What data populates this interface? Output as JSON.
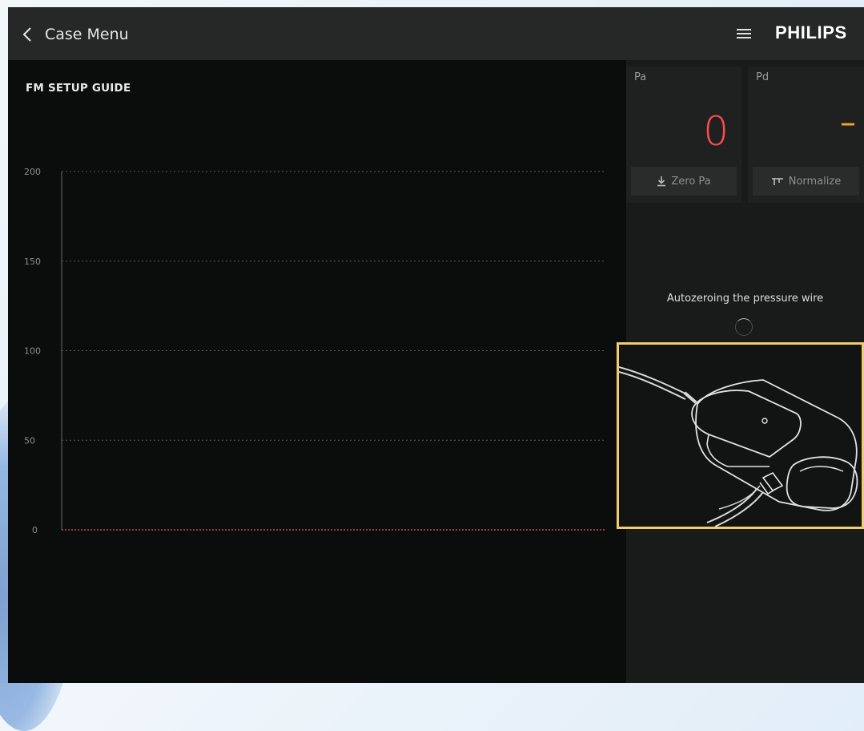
{
  "header": {
    "back_label": "Case Menu",
    "brand": "PHILIPS",
    "icons": {
      "back": "chevron-left-icon",
      "menu": "hamburger-menu-icon"
    }
  },
  "guide": {
    "title": "FM SETUP GUIDE"
  },
  "chart_data": {
    "type": "line",
    "title": "",
    "xlabel": "",
    "ylabel": "",
    "ylim": [
      0,
      200
    ],
    "yticks": [
      "200",
      "150",
      "100",
      "50",
      "0"
    ],
    "grid": true,
    "series": [
      {
        "values": [
          0,
          0
        ],
        "color": "#c44a4a"
      }
    ]
  },
  "pressure": {
    "pa": {
      "label": "Pa",
      "value": "0",
      "button": "Zero Pa",
      "color": "#ff4d4d"
    },
    "pd": {
      "label": "Pd",
      "value": "–",
      "button": "Normalize",
      "color": "#f3a81c"
    }
  },
  "status": {
    "message": "Autozeroing the pressure wire"
  },
  "colors": {
    "highlight": "#f2cd6b",
    "background": "#0b0c0c",
    "topbar": "#262727"
  }
}
